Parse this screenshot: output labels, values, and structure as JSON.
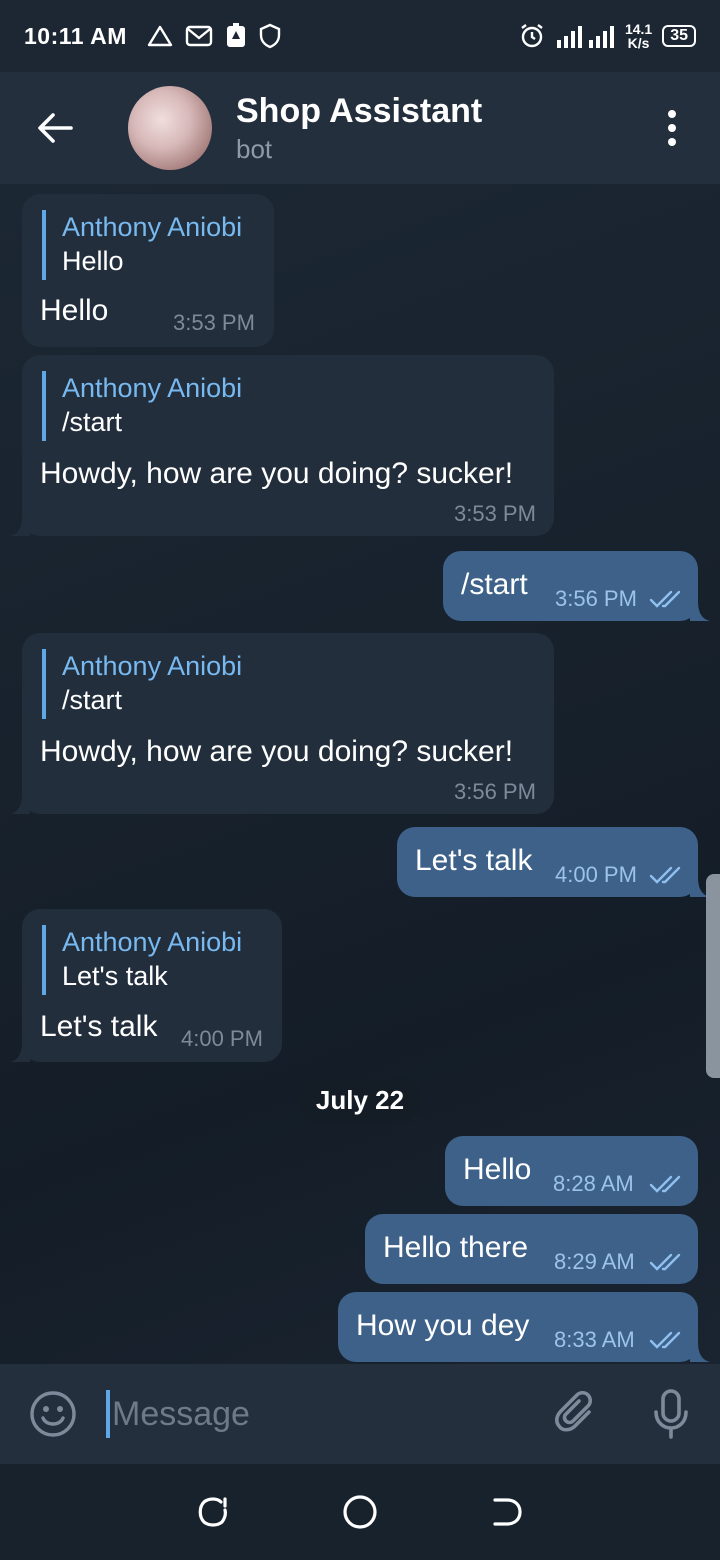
{
  "status_bar": {
    "time": "10:11 AM",
    "speed_value": "14.1",
    "speed_unit": "K/s",
    "battery": "35"
  },
  "header": {
    "title": "Shop Assistant",
    "subtitle": "bot"
  },
  "messages": [
    {
      "direction": "in",
      "reply_name": "Anthony Aniobi",
      "reply_text": "Hello",
      "text": "Hello",
      "time": "3:53 PM"
    },
    {
      "direction": "in",
      "reply_name": "Anthony Aniobi",
      "reply_text": "/start",
      "text": "Howdy, how are you doing? sucker!",
      "time": "3:53 PM"
    },
    {
      "direction": "out",
      "text": "/start",
      "time": "3:56 PM",
      "read": true
    },
    {
      "direction": "in",
      "reply_name": "Anthony Aniobi",
      "reply_text": "/start",
      "text": "Howdy, how are you doing? sucker!",
      "time": "3:56 PM"
    },
    {
      "direction": "out",
      "text": "Let's talk",
      "time": "4:00 PM",
      "read": true
    },
    {
      "direction": "in",
      "reply_name": "Anthony Aniobi",
      "reply_text": "Let's talk",
      "text": "Let's talk",
      "time": "4:00 PM"
    },
    {
      "direction": "out",
      "text": "Hello",
      "time": "8:28 AM",
      "read": true
    },
    {
      "direction": "out",
      "text": "Hello there",
      "time": "8:29 AM",
      "read": true
    },
    {
      "direction": "out",
      "text": "How you dey",
      "time": "8:33 AM",
      "read": true
    }
  ],
  "date_divider": "July 22",
  "input": {
    "placeholder": "Message"
  },
  "colors": {
    "accent": "#5fa8e8",
    "incoming_bubble": "#222e3b",
    "outgoing_bubble": "#3e6189",
    "header_bg": "#242f3d"
  },
  "icons": {
    "back": "arrow-left-icon",
    "menu": "more-vertical-icon",
    "emoji": "emoji-icon",
    "attach": "paperclip-icon",
    "mic": "microphone-icon",
    "read": "double-check-icon"
  }
}
